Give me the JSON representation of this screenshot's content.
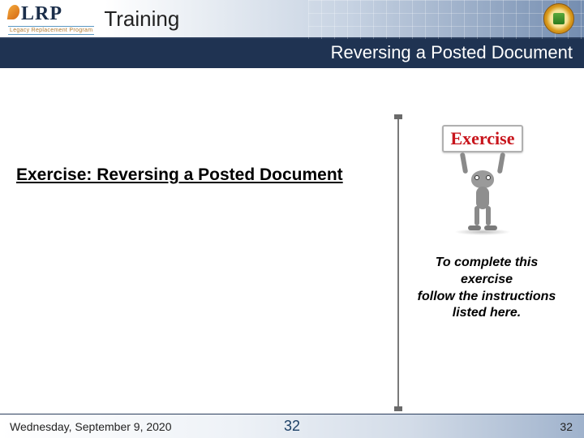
{
  "header": {
    "logo_text": "LRP",
    "logo_subtext": "Legacy Replacement Program",
    "title": "Training"
  },
  "subheader": "Reversing a Posted Document",
  "content": {
    "exercise_title": "Exercise: Reversing a Posted Document",
    "sign_label": "Exercise",
    "instructions_line1": "To complete this",
    "instructions_line2": "exercise",
    "instructions_line3": "follow the instructions",
    "instructions_line4": "listed here."
  },
  "footer": {
    "date": "Wednesday, September 9, 2020",
    "center_page": "32",
    "right_page": "32"
  }
}
